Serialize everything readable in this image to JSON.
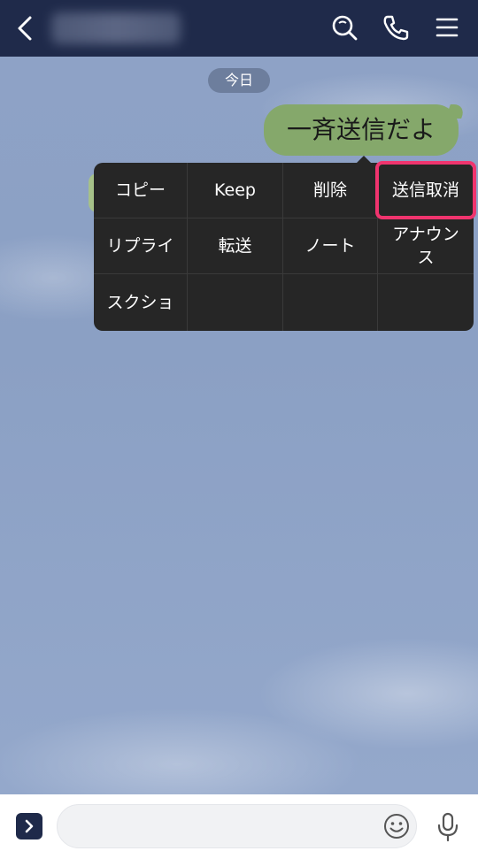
{
  "header": {
    "back_icon": "chevron-left-icon",
    "icons": [
      "search-icon",
      "phone-icon",
      "menu-icon"
    ],
    "colors": {
      "background": "#1f2a4a"
    }
  },
  "chat": {
    "date_label": "今日",
    "message": {
      "text": "一斉送信だよ",
      "bubble_color": "#85a86b"
    }
  },
  "context_menu": {
    "items": [
      [
        "コピー",
        "Keep",
        "削除",
        "送信取消"
      ],
      [
        "リプライ",
        "転送",
        "ノート",
        "アナウンス"
      ],
      [
        "スクショ",
        "",
        "",
        ""
      ]
    ],
    "highlighted": "送信取消",
    "highlight_color": "#f0346e"
  },
  "input_bar": {
    "placeholder": "",
    "icons": [
      "expand-icon",
      "emoji-icon",
      "microphone-icon"
    ]
  }
}
